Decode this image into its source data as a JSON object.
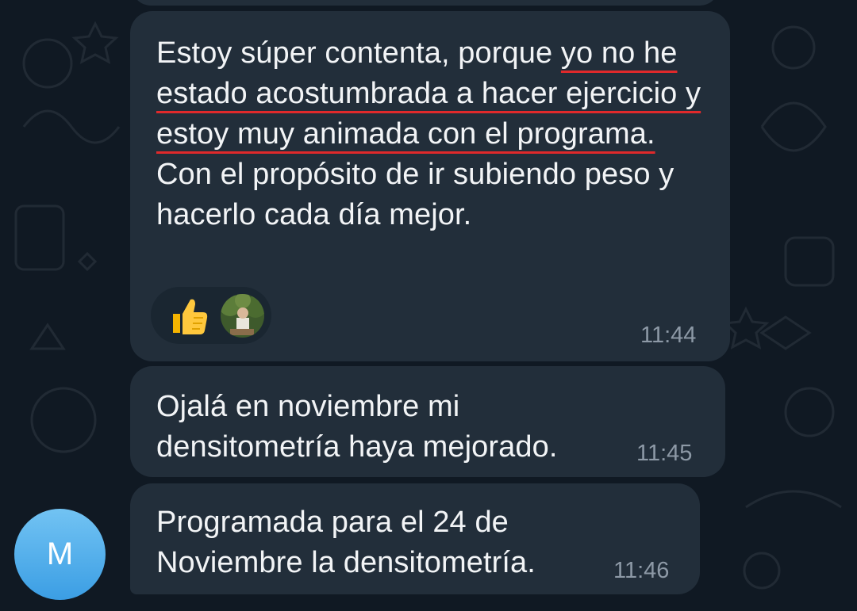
{
  "messages": [
    {
      "segments": [
        {
          "text": "Estoy súper contenta, porque ",
          "hl": false
        },
        {
          "text": "yo no he estado acostumbrada a hacer ejercicio y estoy muy animada con el programa.",
          "hl": true
        },
        {
          "text": " Con el propósito de ir subiendo peso y hacerlo cada día mejor.",
          "hl": false
        }
      ],
      "time": "11:44",
      "reactions": [
        "thumbs-up-icon",
        "reactor-avatar"
      ]
    },
    {
      "text": "Ojalá en noviembre mi densitometría haya mejorado.",
      "time": "11:45"
    },
    {
      "text": "Programada para el 24 de Noviembre la densitometría.",
      "time": "11:46"
    }
  ],
  "sender_avatar": {
    "initial": "M",
    "color_top": "#72c3f3",
    "color_bottom": "#3b9ee4"
  },
  "colors": {
    "background": "#101923",
    "bubble": "#222e3a",
    "text": "#f2f4f6",
    "time": "#8d99a6",
    "underline": "#e0292b"
  }
}
